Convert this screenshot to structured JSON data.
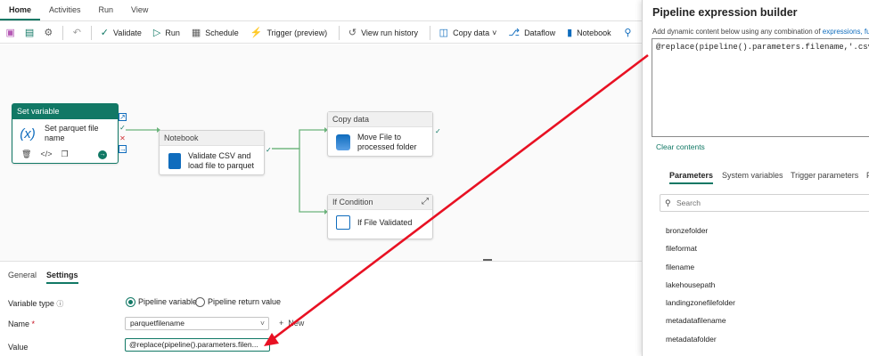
{
  "topnav": {
    "tabs": [
      "Home",
      "Activities",
      "Run",
      "View"
    ]
  },
  "toolbar": {
    "validate": "Validate",
    "run": "Run",
    "schedule": "Schedule",
    "trigger": "Trigger (preview)",
    "view_run_history": "View run history",
    "copy_data": "Copy data",
    "dataflow": "Dataflow",
    "notebook": "Notebook"
  },
  "canvas": {
    "set_variable": {
      "header": "Set variable",
      "label": "Set parquet file name"
    },
    "notebook": {
      "header": "Notebook",
      "label": "Validate CSV and load file to parquet"
    },
    "copy_data": {
      "header": "Copy data",
      "label": "Move File to processed folder"
    },
    "if_condition": {
      "header": "If Condition",
      "label": "If File Validated"
    }
  },
  "bottom": {
    "tabs": [
      "General",
      "Settings"
    ],
    "variable_type_label": "Variable type",
    "radio_pipeline_variable": "Pipeline variable",
    "radio_pipeline_return": "Pipeline return value",
    "name_label": "Name",
    "name_required": "*",
    "name_value": "parquetfilename",
    "new_label": "New",
    "value_label": "Value",
    "value_text": "@replace(pipeline().parameters.filen..."
  },
  "panel": {
    "title": "Pipeline expression builder",
    "subtitle": "Add dynamic content below using any combination of",
    "subtitle_link": "expressions, fu",
    "expression": "@replace(pipeline().parameters.filename,'.csv','')",
    "clear": "Clear contents",
    "tabs": [
      "Parameters",
      "System variables",
      "Trigger parameters",
      "F"
    ],
    "search_placeholder": "Search",
    "parameters": [
      "bronzefolder",
      "fileformat",
      "filename",
      "lakehousepath",
      "landingzonefilefolder",
      "metadatafilename",
      "metadatafolder"
    ]
  },
  "colors": {
    "accent": "#117865",
    "arrow": "#e81123"
  }
}
